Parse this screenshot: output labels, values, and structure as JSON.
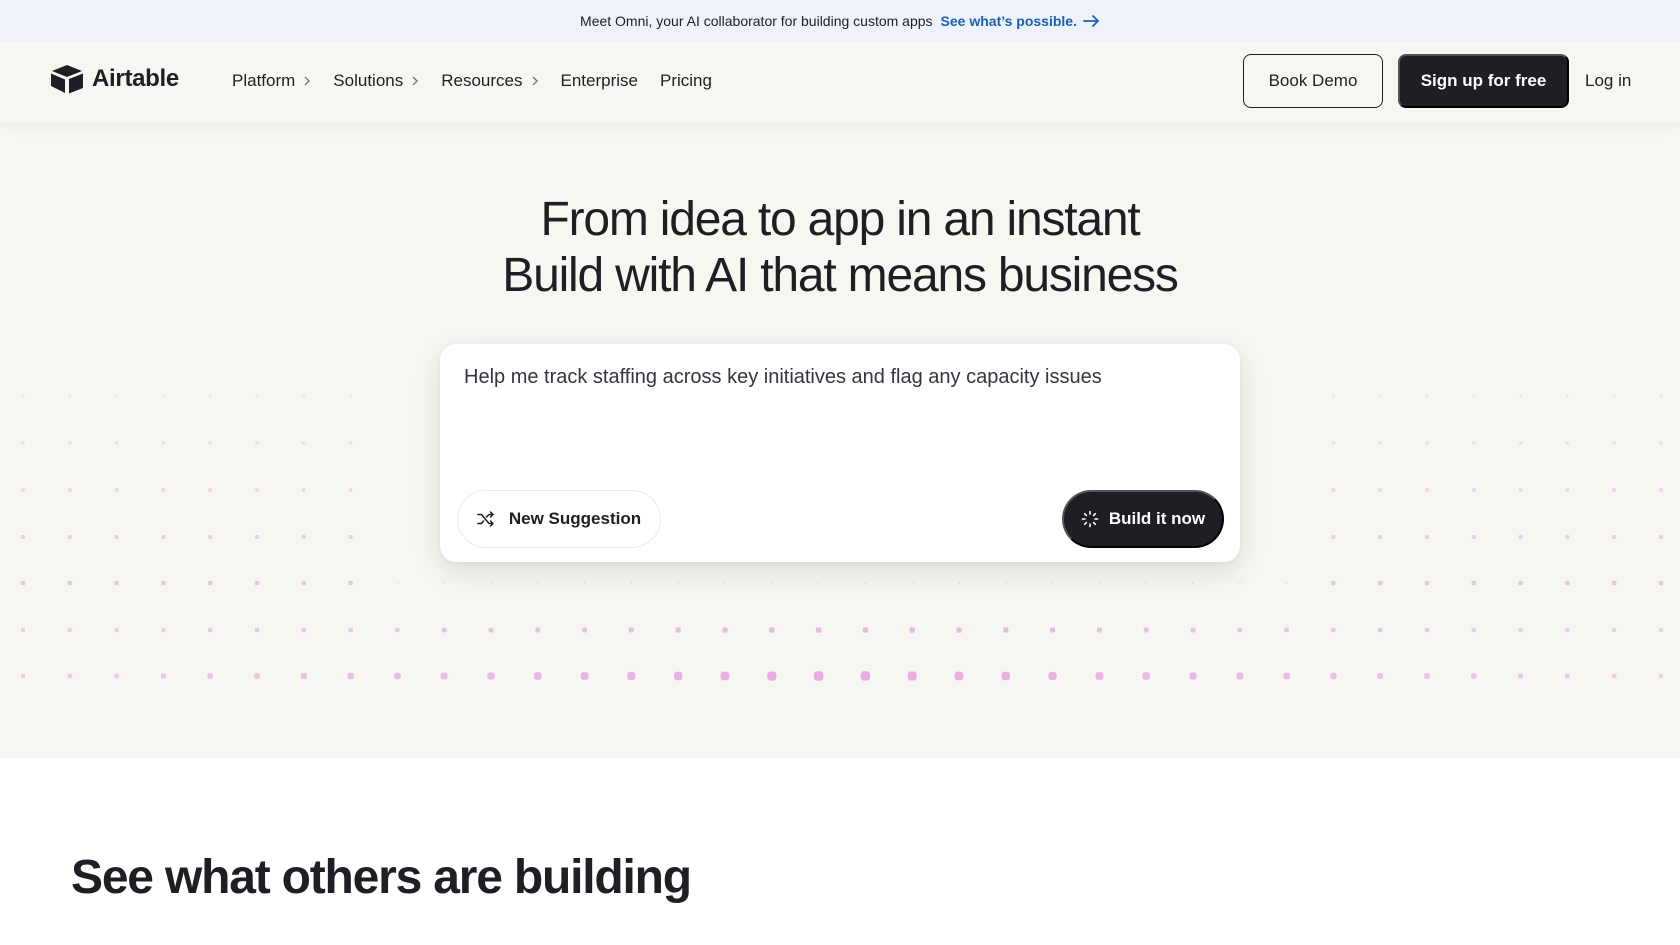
{
  "announcement": {
    "text": "Meet Omni, your AI collaborator for building custom apps",
    "link": "See what’s possible."
  },
  "brand": {
    "name": "Airtable"
  },
  "nav": {
    "items": [
      {
        "label": "Platform",
        "has_submenu": true
      },
      {
        "label": "Solutions",
        "has_submenu": true
      },
      {
        "label": "Resources",
        "has_submenu": true
      },
      {
        "label": "Enterprise",
        "has_submenu": false
      },
      {
        "label": "Pricing",
        "has_submenu": false
      }
    ],
    "book_demo": "Book Demo",
    "signup": "Sign up for free",
    "login": "Log in"
  },
  "hero": {
    "line1": "From idea to app in an instant",
    "line2": "Build with AI that means business",
    "prompt": "Help me track staffing across key initiatives and flag any capacity issues",
    "suggest_label": "New Suggestion",
    "build_label": "Build it now"
  },
  "section": {
    "title": "See what others are building"
  },
  "colors": {
    "accent_link": "#1c5fb0",
    "dark": "#1d1f25",
    "hero_bg": "#f7f7f2",
    "dot": "#e7a6e3"
  },
  "icons": {
    "logo": "airtable-logo-icon",
    "arrow": "arrow-right-icon",
    "chevron": "chevron-right-icon",
    "shuffle": "shuffle-icon",
    "sparkle": "spinner-icon"
  }
}
